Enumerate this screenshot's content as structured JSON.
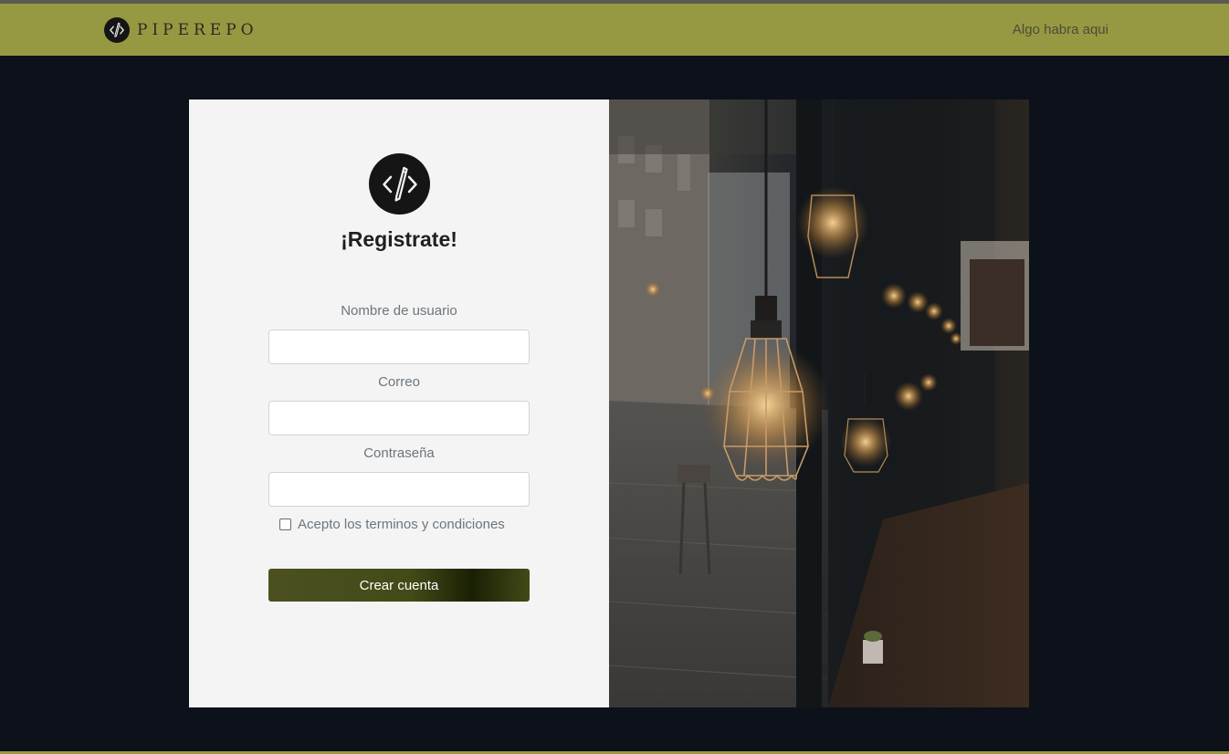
{
  "navbar": {
    "brand_text": "PIPEREPO",
    "brand_icon": "code-pencil-icon",
    "link_label": "Algo habra aqui",
    "color": "#969941"
  },
  "form": {
    "logo_icon": "code-pencil-icon",
    "title": "¡Registrate!",
    "fields": [
      {
        "label": "Nombre de usuario",
        "value": "",
        "placeholder": ""
      },
      {
        "label": "Correo",
        "value": "",
        "placeholder": ""
      },
      {
        "label": "Contraseña",
        "value": "",
        "placeholder": ""
      }
    ],
    "terms_label": "Acepto los terminos y condiciones",
    "terms_checked": false,
    "submit_label": "Crear cuenta"
  },
  "photo": {
    "subject": "hanging-edison-lamps-cafe-photo"
  },
  "colors": {
    "background": "#0c111a",
    "panel": "#f4f4f4",
    "button": "#434a17"
  }
}
